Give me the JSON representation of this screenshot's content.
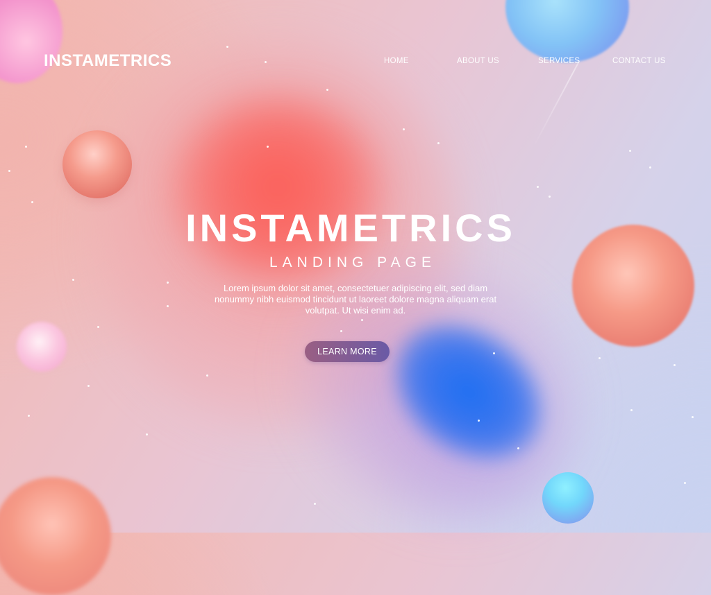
{
  "header": {
    "logo": "INSTAMETRICS",
    "nav": {
      "home": "HOME",
      "about": "ABOUT US",
      "services": "SERVICES",
      "contact": "CONTACT US"
    }
  },
  "hero": {
    "title": "INSTAMETRICS",
    "subtitle": "LANDING PAGE",
    "body": "Lorem ipsum dolor sit amet, consectetuer adipiscing elit, sed diam nonummy nibh euismod tincidunt ut laoreet dolore magna aliquam erat volutpat. Ut wisi enim ad.",
    "cta_label": "LEARN MORE"
  },
  "colors": {
    "text": "#ffffff",
    "blob_red": "#fb5e57",
    "blob_blue": "#1d6ff2",
    "cta_start": "#9a5f83",
    "cta_end": "#6a5aa6"
  }
}
